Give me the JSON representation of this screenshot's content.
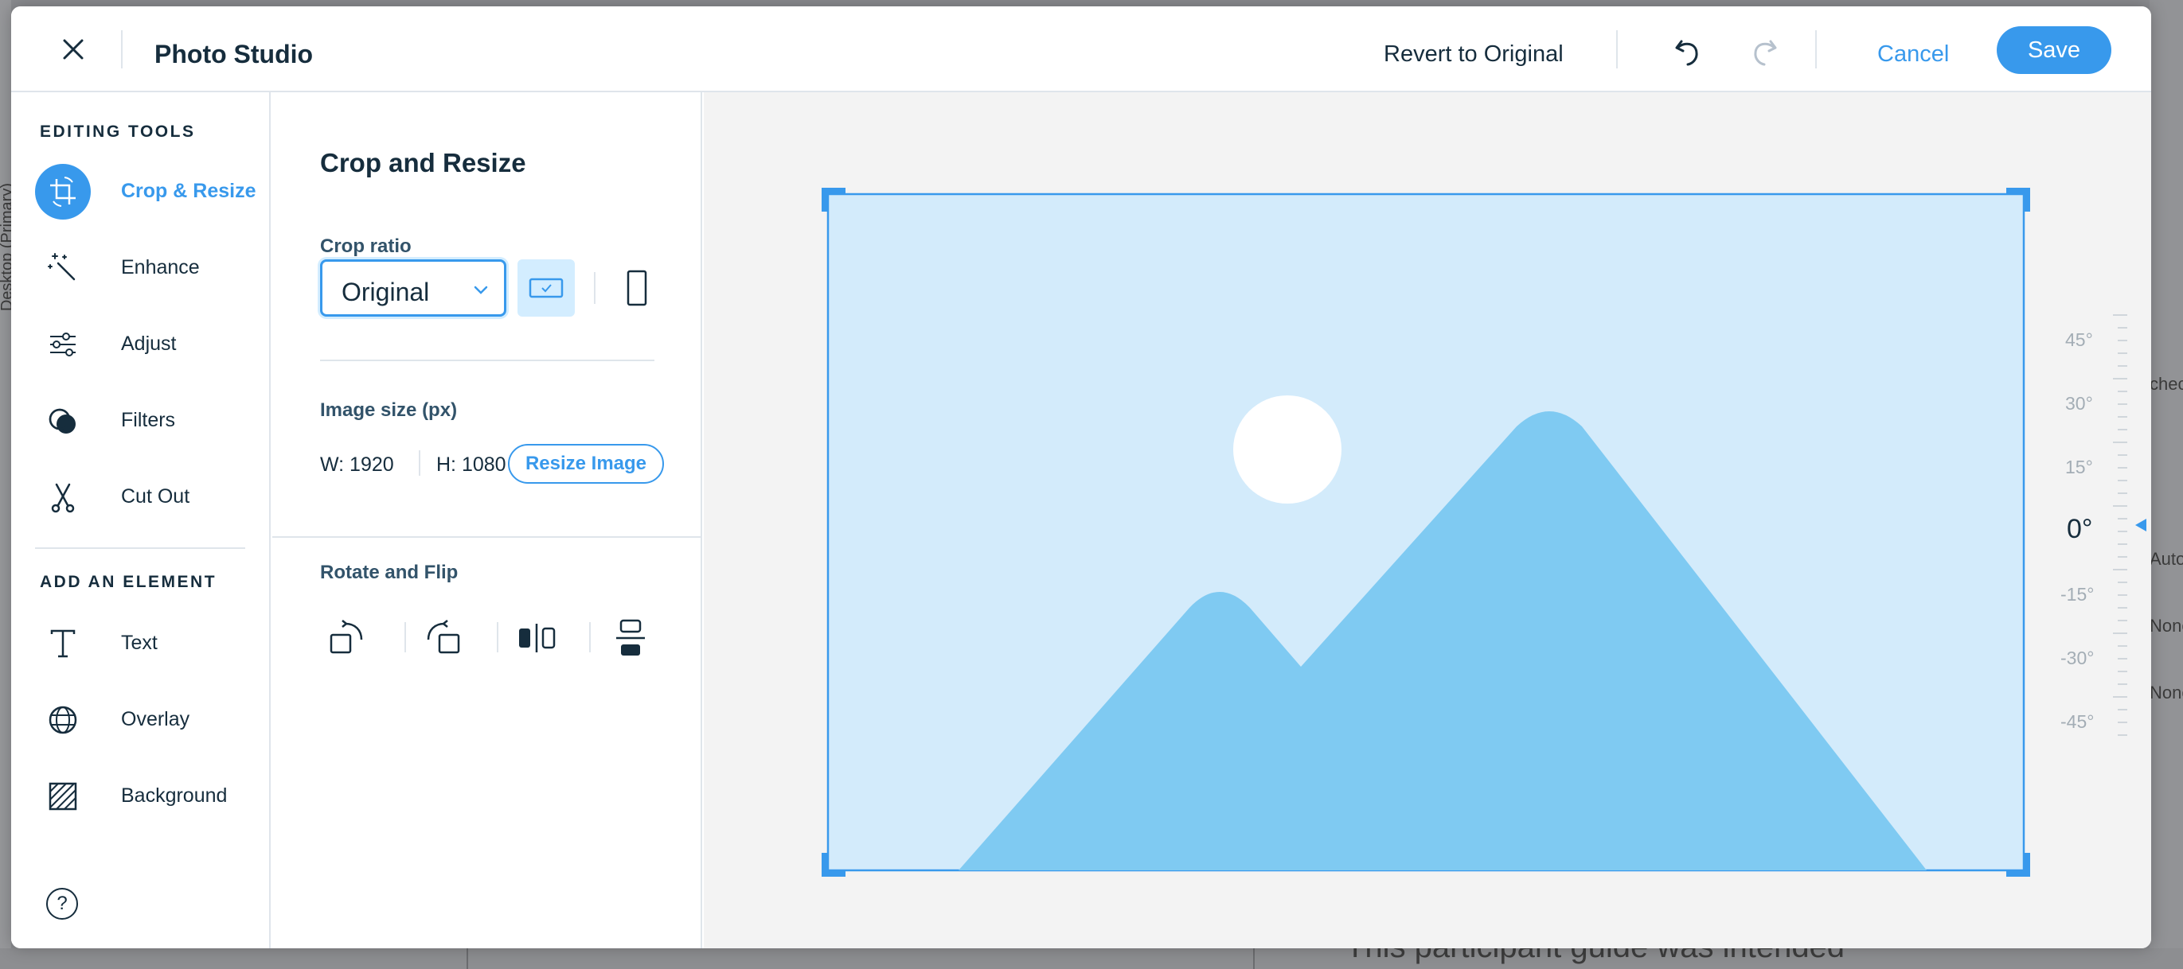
{
  "background": {
    "left_text": "Desktop (Primary)",
    "bottom_text": "This participant guide was intended",
    "right_glyphs": [
      "checl",
      "Auto",
      "None",
      "None"
    ]
  },
  "header": {
    "title": "Photo Studio",
    "revert_label": "Revert to Original",
    "cancel_label": "Cancel",
    "save_label": "Save"
  },
  "tools": {
    "editing_title": "EDITING TOOLS",
    "editing_items": [
      {
        "label": "Crop & Resize",
        "icon": "crop-icon",
        "active": true
      },
      {
        "label": "Enhance",
        "icon": "magic-wand-icon",
        "active": false
      },
      {
        "label": "Adjust",
        "icon": "sliders-icon",
        "active": false
      },
      {
        "label": "Filters",
        "icon": "filters-icon",
        "active": false
      },
      {
        "label": "Cut Out",
        "icon": "scissors-icon",
        "active": false
      }
    ],
    "element_title": "ADD AN ELEMENT",
    "element_items": [
      {
        "label": "Text",
        "icon": "text-icon"
      },
      {
        "label": "Overlay",
        "icon": "overlay-icon"
      },
      {
        "label": "Background",
        "icon": "background-icon"
      }
    ],
    "help_glyph": "?"
  },
  "panel": {
    "title": "Crop and Resize",
    "crop_ratio_label": "Crop ratio",
    "crop_ratio_value": "Original",
    "image_size_label": "Image size (px)",
    "width_text": "W: 1920",
    "height_text": "H: 1080",
    "resize_label": "Resize Image",
    "rotate_flip_label": "Rotate and Flip"
  },
  "canvas": {
    "angles": [
      "45°",
      "30°",
      "15°",
      "0°",
      "-15°",
      "-30°",
      "-45°"
    ],
    "current_angle": "0°"
  },
  "colors": {
    "accent": "#3899ec",
    "accent_light": "#d3edff",
    "text": "#162d3d",
    "photo_bg": "#d3ebfb",
    "mountain": "#7fcaf2"
  }
}
